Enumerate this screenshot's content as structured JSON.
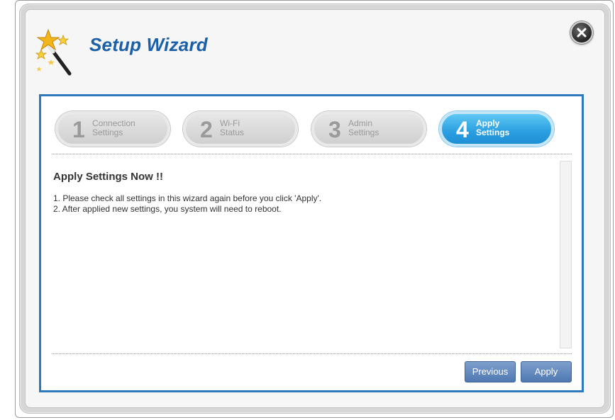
{
  "window": {
    "title": "Setup Wizard"
  },
  "steps": [
    {
      "number": "1",
      "line1": "Connection",
      "line2": "Settings",
      "active": false
    },
    {
      "number": "2",
      "line1": "Wi-Fi",
      "line2": "Status",
      "active": false
    },
    {
      "number": "3",
      "line1": "Admin",
      "line2": "Settings",
      "active": false
    },
    {
      "number": "4",
      "line1": "Apply",
      "line2": "Settings",
      "active": true
    }
  ],
  "content": {
    "heading": "Apply Settings Now !!",
    "lines": [
      "1. Please check all settings in this wizard again before you click 'Apply'.",
      "2. After applied new settings, you system will need to reboot."
    ]
  },
  "buttons": {
    "previous_label": "Previous",
    "apply_label": "Apply"
  },
  "icons": {
    "header_icon": "magic-wand-icon",
    "close_icon": "close-icon"
  },
  "colors": {
    "title": "#1a5fa8",
    "panel_border": "#2e78bd",
    "active_step": "#2a9ee0",
    "button": "#5b82b8"
  }
}
